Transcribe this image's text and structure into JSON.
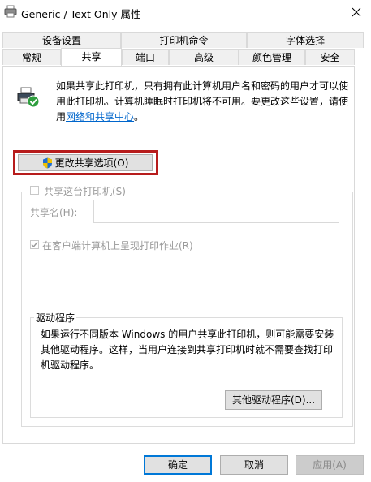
{
  "window": {
    "title": "Generic / Text Only 属性"
  },
  "tabs_row1": [
    {
      "label": "设备设置"
    },
    {
      "label": "打印机命令"
    },
    {
      "label": "字体选择"
    }
  ],
  "tabs_row2": [
    {
      "label": "常规"
    },
    {
      "label": "共享",
      "selected": true
    },
    {
      "label": "端口"
    },
    {
      "label": "高级"
    },
    {
      "label": "颜色管理"
    },
    {
      "label": "安全"
    }
  ],
  "sharing": {
    "description": "如果共享此打印机，只有拥有此计算机用户名和密码的用户才可以使用此打印机。计算机睡眠时打印机将不可用。要更改这些设置，请使用",
    "link_text": "网络和共享中心",
    "link_suffix": "。",
    "change_button_label": "更改共享选项(O)",
    "share_checkbox_label": "共享这台打印机(S)",
    "share_checked": false,
    "share_name_label": "共享名(H):",
    "share_name_value": "",
    "render_jobs_label": "在客户端计算机上呈现打印作业(R)",
    "render_jobs_checked": true
  },
  "drivers": {
    "group_label": "驱动程序",
    "description": "如果运行不同版本 Windows 的用户共享此打印机，则可能需要安装其他驱动程序。这样，当用户连接到共享打印机时就不需要查找打印机驱动程序。",
    "button_label": "其他驱动程序(D)..."
  },
  "footer": {
    "ok_label": "确定",
    "cancel_label": "取消",
    "apply_label": "应用(A)"
  },
  "colors": {
    "link": "#0066cc",
    "highlight_border": "#b71c1c",
    "default_button_border": "#0078d7",
    "check_green": "#2e9e3e"
  },
  "icons": {
    "title": "printer-icon",
    "close": "close-icon",
    "main": "printer-shared-check-icon",
    "uac": "uac-shield-icon",
    "checkmark": "checkmark-icon"
  }
}
